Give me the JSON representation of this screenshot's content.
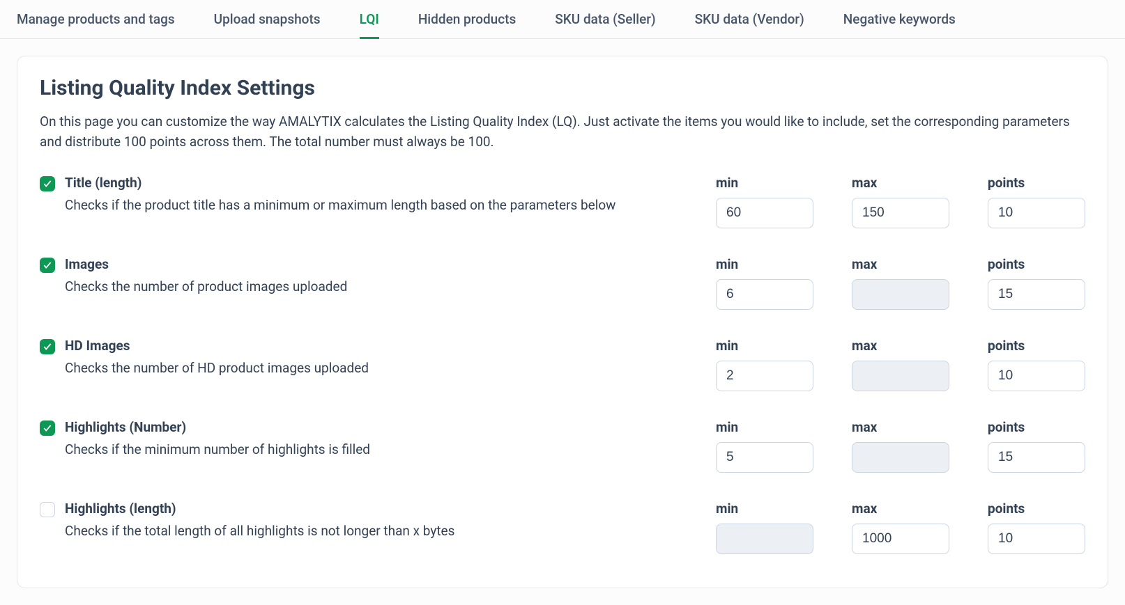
{
  "tabs": [
    {
      "label": "Manage products and tags",
      "active": false
    },
    {
      "label": "Upload snapshots",
      "active": false
    },
    {
      "label": "LQI",
      "active": true
    },
    {
      "label": "Hidden products",
      "active": false
    },
    {
      "label": "SKU data (Seller)",
      "active": false
    },
    {
      "label": "SKU data (Vendor)",
      "active": false
    },
    {
      "label": "Negative keywords",
      "active": false
    }
  ],
  "panel": {
    "title": "Listing Quality Index Settings",
    "description": "On this page you can customize the way AMALYTIX calculates the Listing Quality Index (LQ). Just activate the items you would like to include, set the corresponding parameters and distribute 100 points across them. The total number must always be 100."
  },
  "labels": {
    "min": "min",
    "max": "max",
    "points": "points"
  },
  "rows": [
    {
      "checked": true,
      "title": "Title (length)",
      "desc": "Checks if the product title has a minimum or maximum length based on the parameters below",
      "min": "60",
      "max": "150",
      "points": "10",
      "minDisabled": false,
      "maxDisabled": false
    },
    {
      "checked": true,
      "title": "Images",
      "desc": "Checks the number of product images uploaded",
      "min": "6",
      "max": "",
      "points": "15",
      "minDisabled": false,
      "maxDisabled": true
    },
    {
      "checked": true,
      "title": "HD Images",
      "desc": "Checks the number of HD product images uploaded",
      "min": "2",
      "max": "",
      "points": "10",
      "minDisabled": false,
      "maxDisabled": true
    },
    {
      "checked": true,
      "title": "Highlights (Number)",
      "desc": "Checks if the minimum number of highlights is filled",
      "min": "5",
      "max": "",
      "points": "15",
      "minDisabled": false,
      "maxDisabled": true
    },
    {
      "checked": false,
      "title": "Highlights (length)",
      "desc": "Checks if the total length of all highlights is not longer than x bytes",
      "min": "",
      "max": "1000",
      "points": "10",
      "minDisabled": true,
      "maxDisabled": false
    }
  ]
}
